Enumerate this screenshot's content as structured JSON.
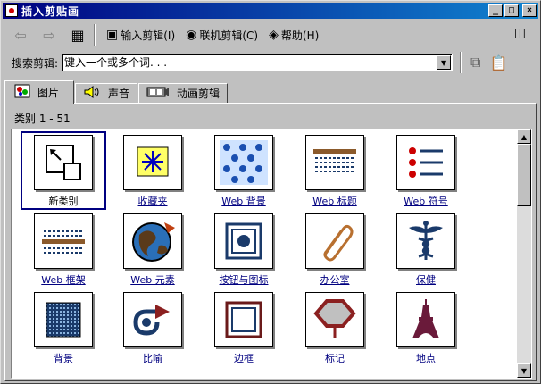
{
  "window": {
    "title": "插入剪贴画",
    "minimize_glyph": "_",
    "maximize_glyph": "□",
    "close_glyph": "×"
  },
  "toolbar": {
    "back_glyph": "⇦",
    "forward_glyph": "⇨",
    "view_glyph": "▦",
    "import_label": "输入剪辑(I)",
    "online_label": "联机剪辑(C)",
    "help_label": "帮助(H)",
    "dock_glyph": "◫"
  },
  "search": {
    "label": "搜索剪辑:",
    "placeholder": "键入一个或多个词. . .",
    "copy_glyph": "⧉",
    "paste_glyph": "📋"
  },
  "tabs": [
    {
      "label": "图片",
      "active": true
    },
    {
      "label": "声音",
      "active": false
    },
    {
      "label": "动画剪辑",
      "active": false
    }
  ],
  "category_range": "类别 1 - 51",
  "gallery": {
    "items": [
      {
        "label": "新类别",
        "icon": "new-category"
      },
      {
        "label": "收藏夹",
        "icon": "favorites"
      },
      {
        "label": "Web 背景",
        "icon": "web-backgrounds"
      },
      {
        "label": "Web 标题",
        "icon": "web-banners"
      },
      {
        "label": "Web 符号",
        "icon": "web-bullets"
      },
      {
        "label": "Web 框架",
        "icon": "web-dividers"
      },
      {
        "label": "Web 元素",
        "icon": "web-elements"
      },
      {
        "label": "按钮与图标",
        "icon": "buttons-icons"
      },
      {
        "label": "办公室",
        "icon": "office"
      },
      {
        "label": "保健",
        "icon": "healthcare"
      },
      {
        "label": "背景",
        "icon": "backgrounds"
      },
      {
        "label": "比喻",
        "icon": "metaphors"
      },
      {
        "label": "边框",
        "icon": "borders"
      },
      {
        "label": "标记",
        "icon": "signs"
      },
      {
        "label": "地点",
        "icon": "places"
      }
    ]
  },
  "scrollbar": {
    "up_glyph": "▲",
    "down_glyph": "▼"
  }
}
